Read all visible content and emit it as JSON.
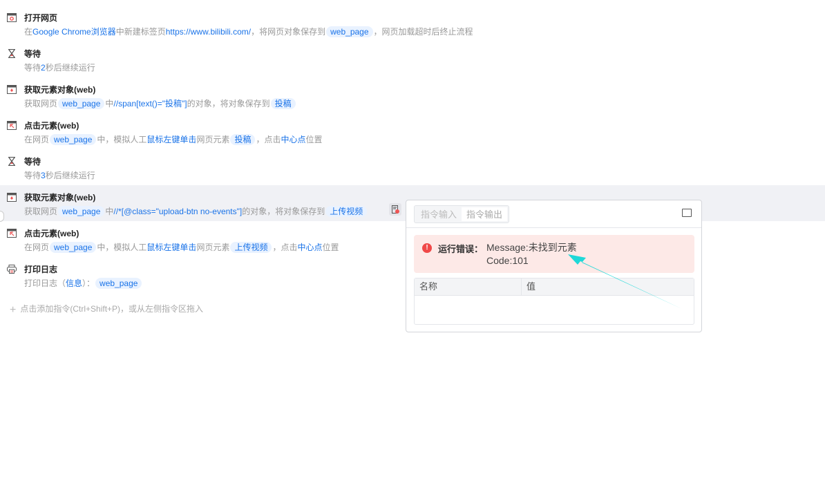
{
  "steps": [
    {
      "icon": "browser-open-icon",
      "title": "打开网页",
      "desc": [
        [
          "在",
          ""
        ],
        [
          "Google Chrome浏览器",
          "b"
        ],
        [
          "中新建标签页",
          ""
        ],
        [
          "https://www.bilibili.com/",
          "b"
        ],
        [
          "，将网页对象保存到",
          ""
        ],
        [
          "web_page",
          "chip"
        ],
        [
          "，网页加载超时后终止流程",
          ""
        ]
      ]
    },
    {
      "icon": "hourglass-icon",
      "title": "等待",
      "desc": [
        [
          "等待",
          ""
        ],
        [
          "2",
          "b"
        ],
        [
          "秒后继续运行",
          ""
        ]
      ]
    },
    {
      "icon": "browser-element-icon",
      "title": "获取元素对象(web)",
      "desc": [
        [
          "获取网页",
          ""
        ],
        [
          "web_page",
          "chip"
        ],
        [
          "中",
          ""
        ],
        [
          "//span[text()=\"投稿\"]",
          "b"
        ],
        [
          "的对象，将对象保存到",
          ""
        ],
        [
          "投稿",
          "chip"
        ]
      ]
    },
    {
      "icon": "browser-click-icon",
      "title": "点击元素(web)",
      "desc": [
        [
          "在网页",
          ""
        ],
        [
          "web_page",
          "chip"
        ],
        [
          "中，模拟人工",
          ""
        ],
        [
          "鼠标左键单击",
          "b"
        ],
        [
          "网页元素",
          ""
        ],
        [
          "投稿",
          "chip"
        ],
        [
          "，点击",
          ""
        ],
        [
          "中心点",
          "b"
        ],
        [
          "位置",
          ""
        ]
      ]
    },
    {
      "icon": "hourglass-icon",
      "title": "等待",
      "desc": [
        [
          "等待",
          ""
        ],
        [
          "3",
          "b"
        ],
        [
          "秒后继续运行",
          ""
        ]
      ]
    },
    {
      "icon": "browser-element-icon",
      "title": "获取元素对象(web)",
      "desc": [
        [
          "获取网页",
          ""
        ],
        [
          "web_page",
          "chip"
        ],
        [
          "中",
          ""
        ],
        [
          "//*[@class=\"upload-btn no-events\"]",
          "b"
        ],
        [
          "的对象，将对象保存到",
          ""
        ],
        [
          "上传视频",
          "chip"
        ]
      ]
    },
    {
      "icon": "browser-click-icon",
      "title": "点击元素(web)",
      "desc": [
        [
          "在网页",
          ""
        ],
        [
          "web_page",
          "chip"
        ],
        [
          "中，模拟人工",
          ""
        ],
        [
          "鼠标左键单击",
          "b"
        ],
        [
          "网页元素",
          ""
        ],
        [
          "上传视频",
          "chip"
        ],
        [
          "，点击",
          ""
        ],
        [
          "中心点",
          "b"
        ],
        [
          "位置",
          ""
        ]
      ]
    },
    {
      "icon": "printer-icon",
      "title": "打印日志",
      "desc": [
        [
          "打印日志（",
          ""
        ],
        [
          "信息",
          "b"
        ],
        [
          "）：",
          ""
        ],
        [
          "web_page",
          "chip"
        ]
      ]
    }
  ],
  "add_hint": "点击添加指令(Ctrl+Shift+P)，或从左侧指令区拖入",
  "panel": {
    "tabs": [
      "指令输入",
      "指令输出"
    ],
    "error_label": "运行错误：",
    "error_message": "Message:未找到元素",
    "error_code": "Code:101",
    "columns": [
      "名称",
      "值"
    ]
  },
  "colors": {
    "accent": "#1a73e8",
    "error": "#f04848",
    "arrow": "#1ed8d8"
  }
}
